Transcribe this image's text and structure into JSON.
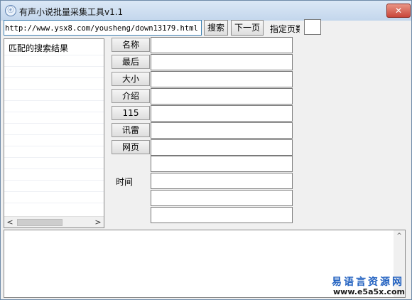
{
  "window": {
    "title": "有声小说批量采集工具v1.1",
    "close_symbol": "✕"
  },
  "toolbar": {
    "url_value": "http://www.ysx8.com/yousheng/down13179.html",
    "search_label": "搜索",
    "next_page_label": "下一页",
    "page_label": "指定页数",
    "page_value": ""
  },
  "results": {
    "header": "匹配的搜索结果",
    "scroll_left": "<",
    "scroll_right": ">"
  },
  "fields": [
    {
      "label": "名称",
      "value": ""
    },
    {
      "label": "最后",
      "value": ""
    },
    {
      "label": "大小",
      "value": ""
    },
    {
      "label": "介绍",
      "value": ""
    },
    {
      "label": "115",
      "value": ""
    },
    {
      "label": "讯雷",
      "value": ""
    },
    {
      "label": "网页",
      "value": ""
    }
  ],
  "time": {
    "label": "时间"
  },
  "log": {
    "value": "",
    "scroll_up": "^"
  },
  "watermark": {
    "name": "易语言资源网",
    "url": "www.e5a5x.com"
  },
  "icons": {
    "app": "app-logo-icon",
    "close": "close-icon"
  }
}
